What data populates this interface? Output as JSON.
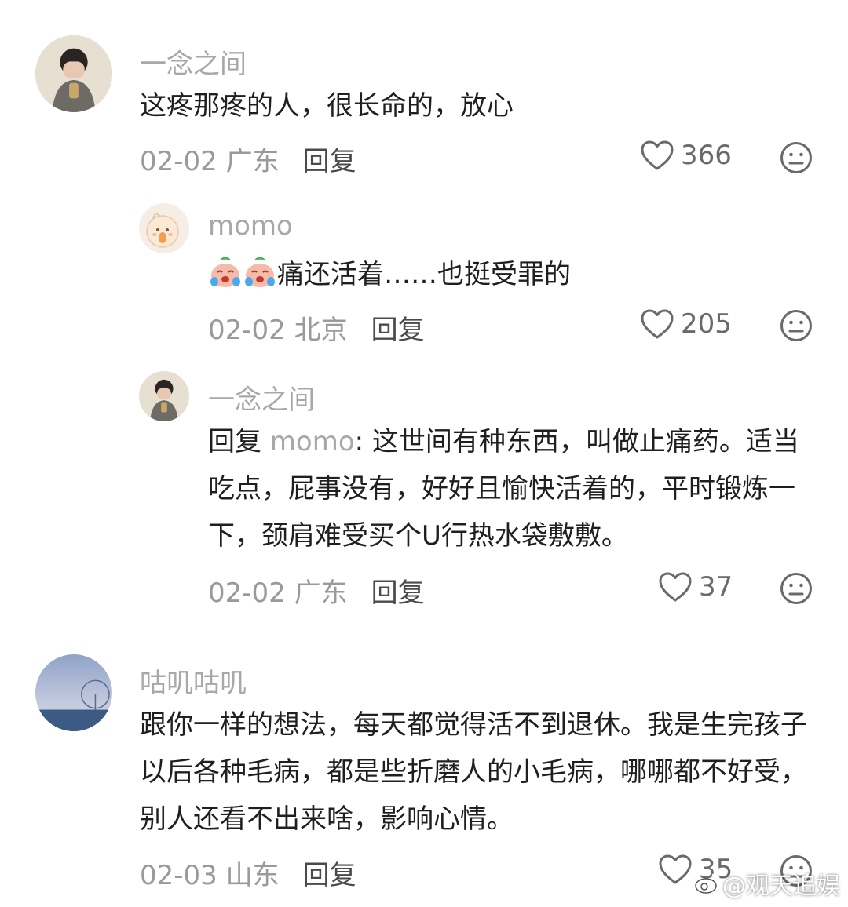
{
  "comments": [
    {
      "username": "一念之间",
      "text": "这疼那疼的人，很长命的，放心",
      "date_location": "02-02 广东",
      "reply_label": "回复",
      "likes": "366"
    },
    {
      "username": "momo",
      "text": "痛还活着……也挺受罪的",
      "date_location": "02-02 北京",
      "reply_label": "回复",
      "likes": "205"
    },
    {
      "username": "一念之间",
      "reply_prefix": "回复 ",
      "mention": "momo",
      "text": ": 这世间有种东西，叫做止痛药。适当吃点，屁事没有，好好且愉快活着的，平时锻炼一下，颈肩难受买个U行热水袋敷敷。",
      "date_location": "02-02 广东",
      "reply_label": "回复",
      "likes": "37"
    },
    {
      "username": "咕叽咕叽",
      "text": "跟你一样的想法，每天都觉得活不到退休。我是生完孩子以后各种毛病，都是些折磨人的小毛病，哪哪都不好受，别人还看不出来啥，影响心情。",
      "date_location": "02-03 山东",
      "reply_label": "回复",
      "likes": "35"
    }
  ],
  "watermark": "@观天追娱",
  "icons": {
    "like": "heart-outline-icon",
    "dislike": "neutral-face-icon",
    "emoji": "crying-peach-emoji",
    "watermark": "weibo-logo-icon"
  }
}
